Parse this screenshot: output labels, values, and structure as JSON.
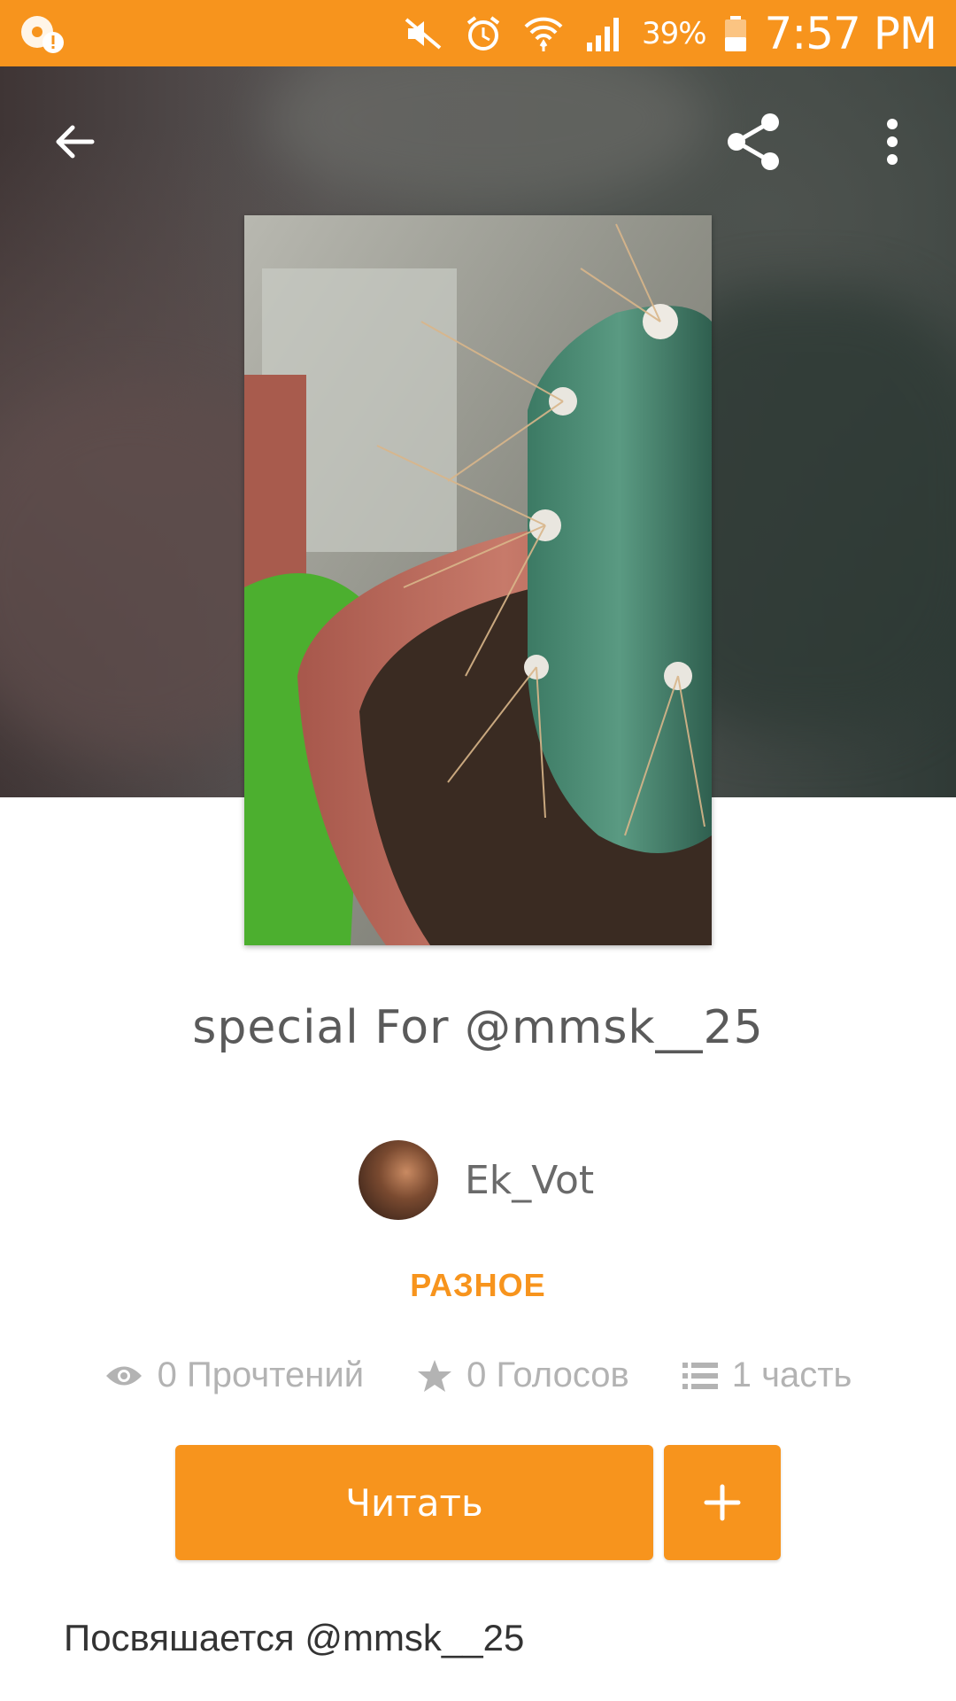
{
  "status_bar": {
    "battery": "39%",
    "time": "7:57 PM"
  },
  "toolbar": {
    "back_icon": "arrow-left-icon",
    "share_icon": "share-icon",
    "more_icon": "more-vertical-icon"
  },
  "story": {
    "title": "special For @mmsk__25",
    "author": "Ek_Vot",
    "category": "РАЗНОЕ",
    "stats": {
      "reads": "0 Прочтений",
      "votes": "0 Голосов",
      "parts": "1 часть"
    },
    "read_button": "Читать",
    "description": "Посвяшается @mmsk__25"
  },
  "colors": {
    "accent": "#f7941d",
    "stats_text": "#b3b3b3"
  }
}
